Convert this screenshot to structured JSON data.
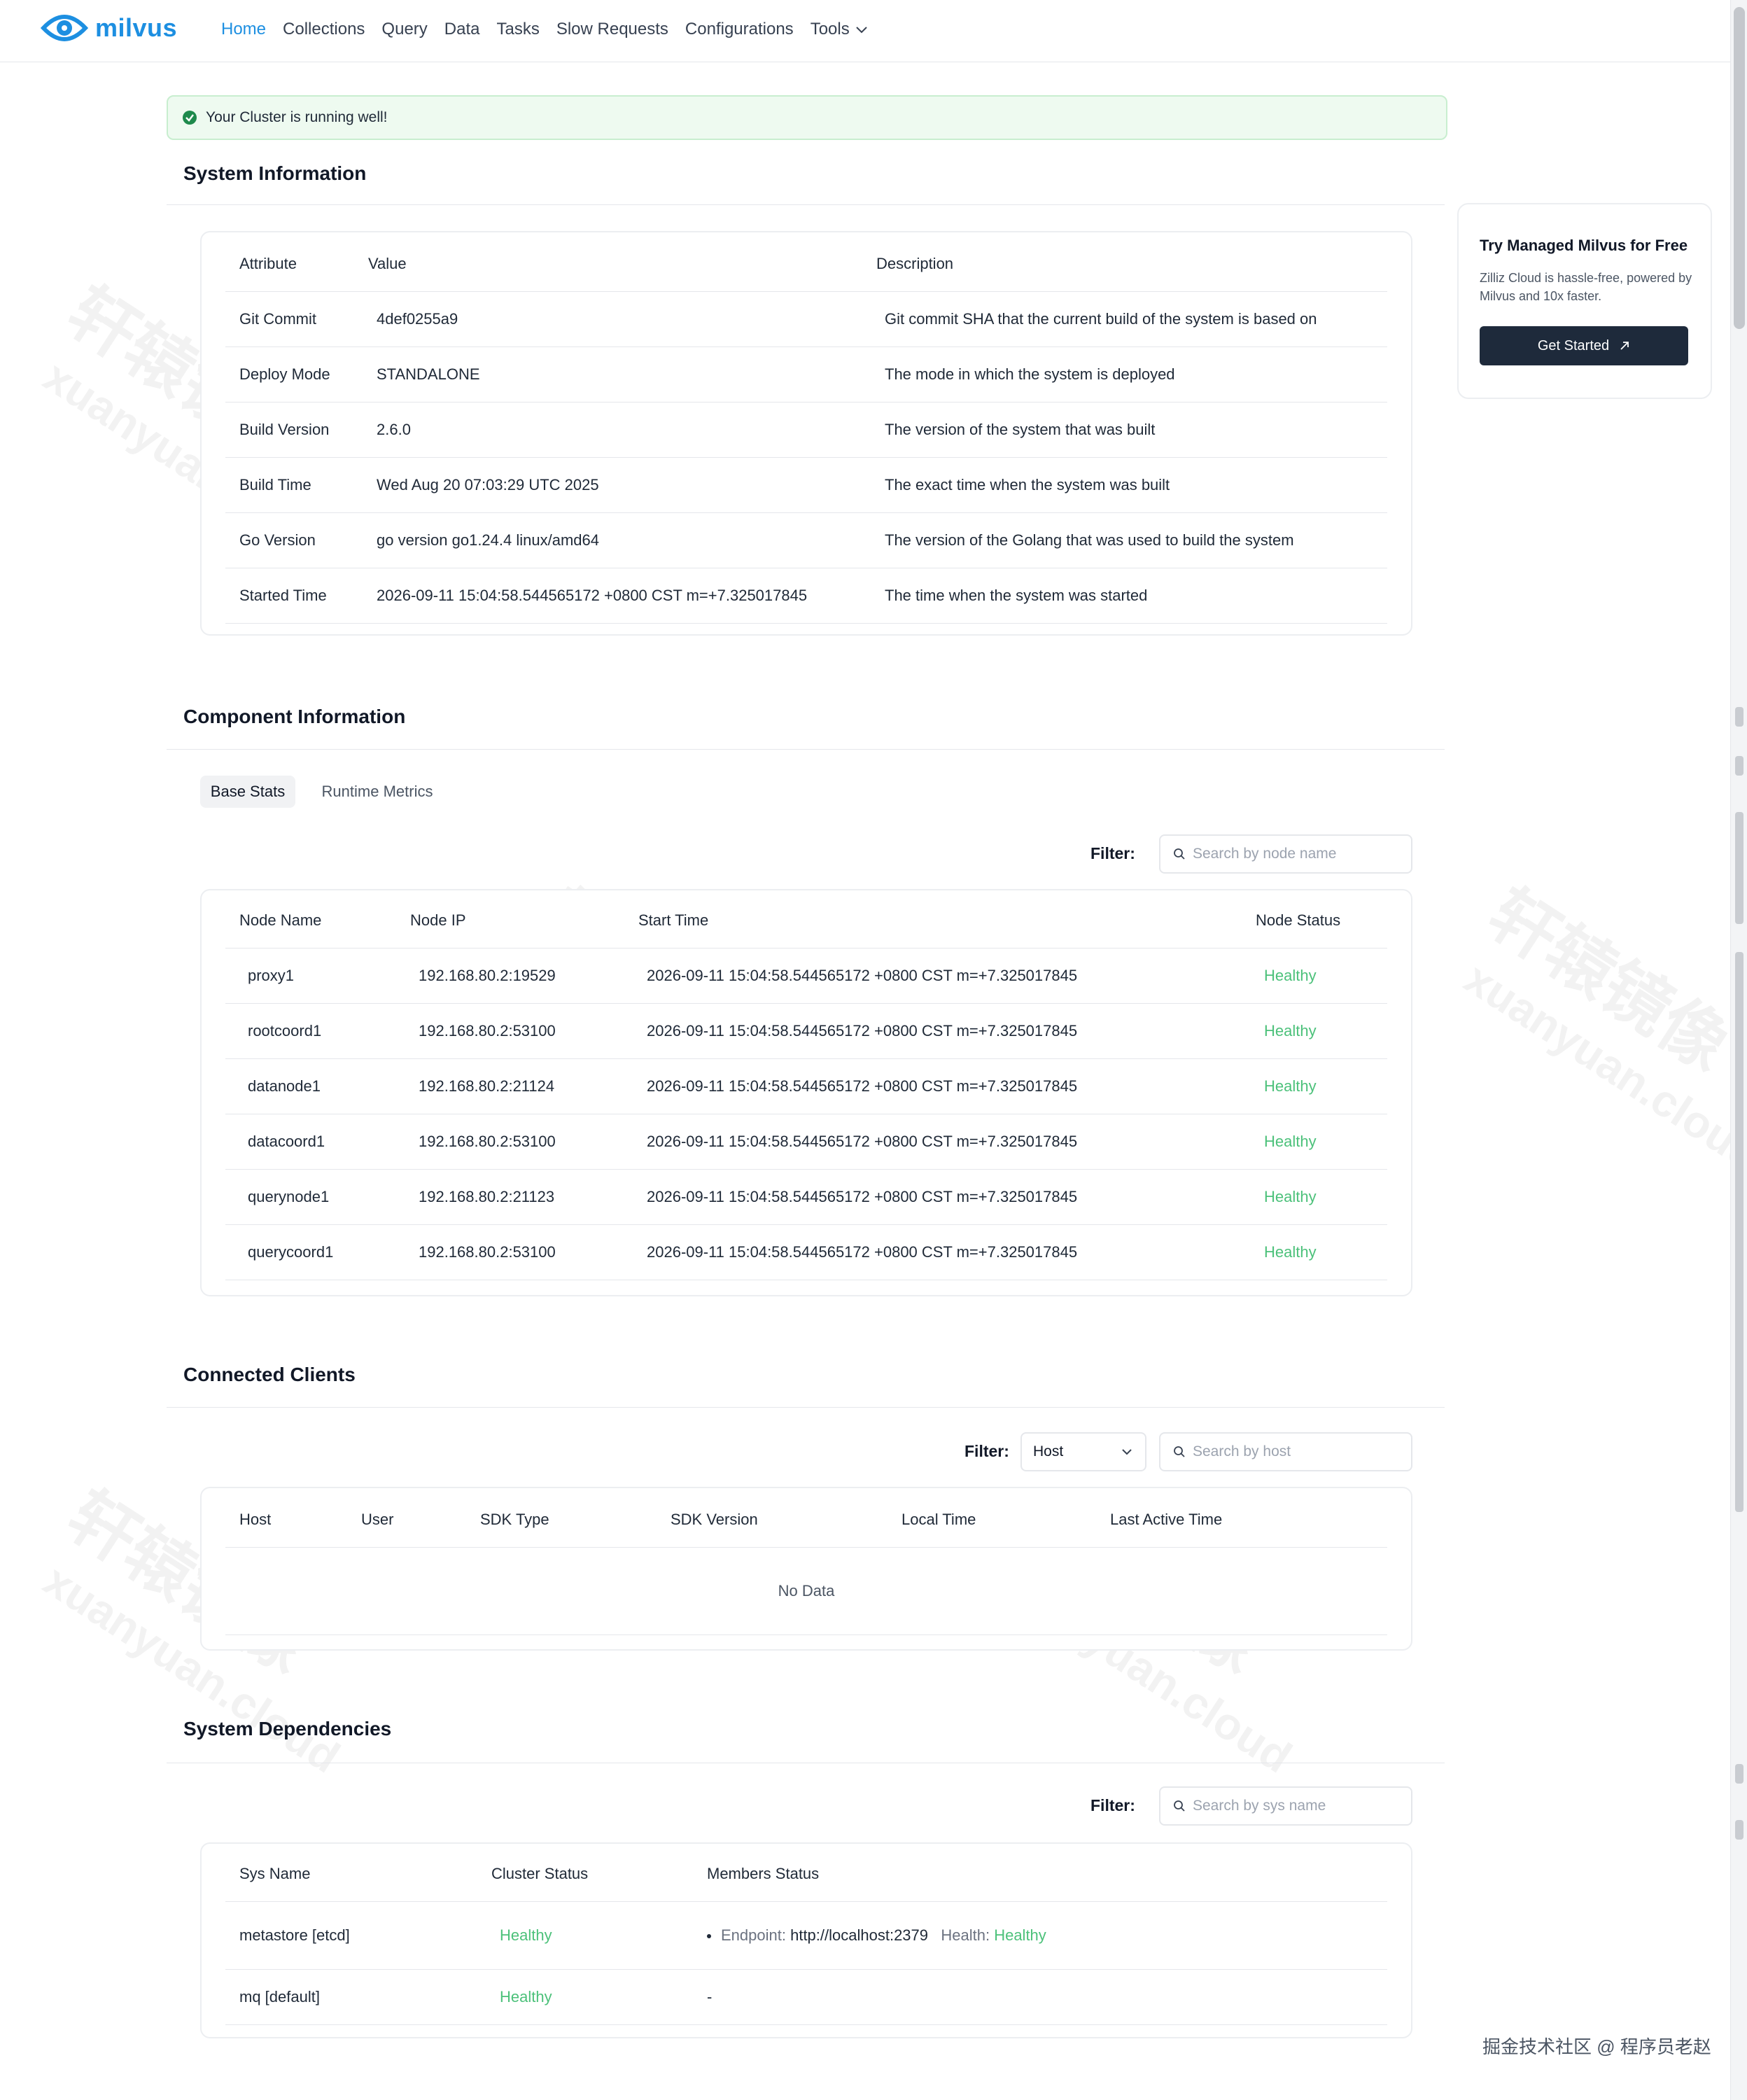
{
  "app": {
    "logo_text": "milvus"
  },
  "nav": {
    "items": [
      {
        "label": "Home"
      },
      {
        "label": "Collections"
      },
      {
        "label": "Query"
      },
      {
        "label": "Data"
      },
      {
        "label": "Tasks"
      },
      {
        "label": "Slow Requests"
      },
      {
        "label": "Configurations"
      },
      {
        "label": "Tools"
      }
    ],
    "active_index": 0
  },
  "alert": {
    "text": "Your Cluster is running well!"
  },
  "system_info": {
    "title": "System Information",
    "headers": [
      "Attribute",
      "Value",
      "Description"
    ],
    "rows": [
      {
        "attribute": "Git Commit",
        "value": "4def0255a9",
        "description": "Git commit SHA that the current build of the system is based on"
      },
      {
        "attribute": "Deploy Mode",
        "value": "STANDALONE",
        "description": "The mode in which the system is deployed"
      },
      {
        "attribute": "Build Version",
        "value": "2.6.0",
        "description": "The version of the system that was built"
      },
      {
        "attribute": "Build Time",
        "value": "Wed Aug 20 07:03:29 UTC 2025",
        "description": "The exact time when the system was built"
      },
      {
        "attribute": "Go Version",
        "value": "go version go1.24.4 linux/amd64",
        "description": "The version of the Golang that was used to build the system"
      },
      {
        "attribute": "Started Time",
        "value": "2026-09-11 15:04:58.544565172 +0800 CST m=+7.325017845",
        "description": "The time when the system was started"
      }
    ]
  },
  "promo": {
    "title": "Try Managed Milvus for Free",
    "desc": "Zilliz Cloud is hassle-free, powered by Milvus and 10x faster.",
    "button": "Get Started"
  },
  "component_info": {
    "title": "Component Information",
    "tabs": [
      {
        "label": "Base Stats"
      },
      {
        "label": "Runtime Metrics"
      }
    ],
    "filter_label": "Filter:",
    "search_placeholder": "Search by node name",
    "headers": [
      "Node Name",
      "Node IP",
      "Start Time",
      "Node Status"
    ],
    "rows": [
      {
        "name": "proxy1",
        "ip": "192.168.80.2:19529",
        "start": "2026-09-11 15:04:58.544565172 +0800 CST m=+7.325017845",
        "status": "Healthy"
      },
      {
        "name": "rootcoord1",
        "ip": "192.168.80.2:53100",
        "start": "2026-09-11 15:04:58.544565172 +0800 CST m=+7.325017845",
        "status": "Healthy"
      },
      {
        "name": "datanode1",
        "ip": "192.168.80.2:21124",
        "start": "2026-09-11 15:04:58.544565172 +0800 CST m=+7.325017845",
        "status": "Healthy"
      },
      {
        "name": "datacoord1",
        "ip": "192.168.80.2:53100",
        "start": "2026-09-11 15:04:58.544565172 +0800 CST m=+7.325017845",
        "status": "Healthy"
      },
      {
        "name": "querynode1",
        "ip": "192.168.80.2:21123",
        "start": "2026-09-11 15:04:58.544565172 +0800 CST m=+7.325017845",
        "status": "Healthy"
      },
      {
        "name": "querycoord1",
        "ip": "192.168.80.2:53100",
        "start": "2026-09-11 15:04:58.544565172 +0800 CST m=+7.325017845",
        "status": "Healthy"
      }
    ]
  },
  "clients": {
    "title": "Connected Clients",
    "filter_label": "Filter:",
    "select_value": "Host",
    "search_placeholder": "Search by host",
    "headers": [
      "Host",
      "User",
      "SDK Type",
      "SDK Version",
      "Local Time",
      "Last Active Time"
    ],
    "empty_text": "No Data"
  },
  "dependencies": {
    "title": "System Dependencies",
    "filter_label": "Filter:",
    "search_placeholder": "Search by sys name",
    "headers": [
      "Sys Name",
      "Cluster Status",
      "Members Status"
    ],
    "rows": [
      {
        "name": "metastore [etcd]",
        "status": "Healthy",
        "endpoint_label": "Endpoint:",
        "endpoint": "http://localhost:2379",
        "health_label": "Health:",
        "health": "Healthy"
      },
      {
        "name": "mq [default]",
        "status": "Healthy",
        "members": "-"
      }
    ]
  },
  "watermark": {
    "cn": "轩辕镜像",
    "en": "xuanyuan.cloud"
  },
  "footer_watermark": "掘金技术社区 @ 程序员老赵",
  "colors": {
    "brand": "#1d8fe1",
    "healthy": "#4cc17a",
    "alert_bg": "#eefaf0",
    "button_dark": "#1e2a3b"
  },
  "icons": [
    "milvus-eye-logo-icon",
    "chevron-down-icon",
    "check-circle-icon",
    "arrow-up-right-icon",
    "search-icon"
  ]
}
